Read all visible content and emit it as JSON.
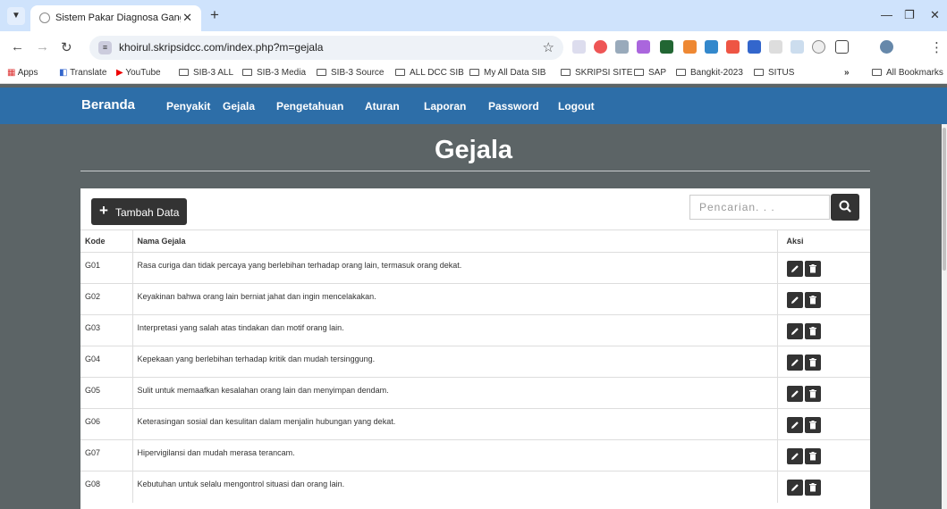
{
  "browser": {
    "tab_title": "Sistem Pakar Diagnosa Ganggu",
    "url": "khoirul.skripsidcc.com/index.php?m=gejala"
  },
  "bookmarks": [
    "Apps",
    "Translate",
    "YouTube",
    "SIB-3 ALL",
    "SIB-3 Media",
    "SIB-3 Source",
    "ALL DCC SIB",
    "My All Data SIB",
    "SKRIPSI SITE",
    "SAP",
    "Bangkit-2023",
    "SITUS"
  ],
  "bookmarks_more": "»",
  "all_bookmarks": "All Bookmarks",
  "nav": {
    "brand": "Beranda",
    "links": [
      "Penyakit",
      "Gejala",
      "Pengetahuan",
      "Aturan",
      "Laporan",
      "Password",
      "Logout"
    ]
  },
  "page": {
    "title": "Gejala",
    "add_label": "Tambah Data",
    "search_placeholder": "Pencarian. . ."
  },
  "table": {
    "headers": [
      "Kode",
      "Nama Gejala",
      "Aksi"
    ],
    "rows": [
      {
        "kode": "G01",
        "nama": "Rasa curiga dan tidak percaya yang berlebihan terhadap orang lain, termasuk orang dekat."
      },
      {
        "kode": "G02",
        "nama": "Keyakinan bahwa orang lain berniat jahat dan ingin mencelakakan."
      },
      {
        "kode": "G03",
        "nama": "Interpretasi yang salah atas tindakan dan motif orang lain."
      },
      {
        "kode": "G04",
        "nama": "Kepekaan yang berlebihan terhadap kritik dan mudah tersinggung."
      },
      {
        "kode": "G05",
        "nama": "Sulit untuk memaafkan kesalahan orang lain dan menyimpan dendam."
      },
      {
        "kode": "G06",
        "nama": "Keterasingan sosial dan kesulitan dalam menjalin hubungan yang dekat."
      },
      {
        "kode": "G07",
        "nama": "Hipervigilansi dan mudah merasa terancam."
      },
      {
        "kode": "G08",
        "nama": "Kebutuhan untuk selalu mengontrol situasi dan orang lain."
      }
    ]
  },
  "colors": {
    "navbar": "#2d6ea8",
    "page_bg": "#5c6466",
    "button": "#333333"
  }
}
